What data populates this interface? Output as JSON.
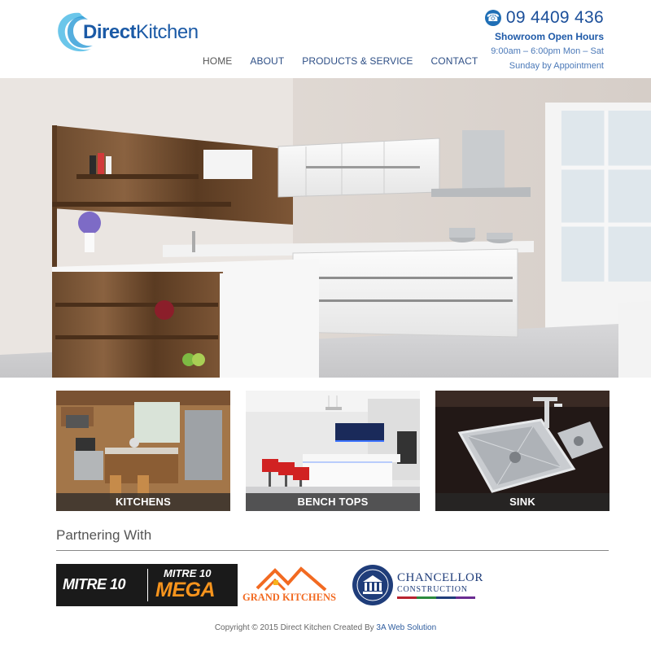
{
  "brand": {
    "name_bold": "Direct",
    "name_light": "Kitchen"
  },
  "nav": {
    "items": [
      {
        "label": "HOME"
      },
      {
        "label": "ABOUT"
      },
      {
        "label": "PRODUCTS & SERVICE"
      },
      {
        "label": "CONTACT"
      }
    ]
  },
  "contact": {
    "phone": "09 4409 436",
    "hours_title": "Showroom Open Hours",
    "hours_line1": "9:00am – 6:00pm Mon – Sat",
    "hours_line2": "Sunday by Appointment"
  },
  "thumbnails": [
    {
      "caption": "KITCHENS"
    },
    {
      "caption": "BENCH TOPS"
    },
    {
      "caption": "SINK"
    }
  ],
  "partners": {
    "title": "Partnering With",
    "mitre10": "MITRE 10",
    "mitre10_mega_top": "MITRE 10",
    "mitre10_mega_bottom": "MEGA",
    "grand_kitchens": "GRAND KITCHENS",
    "chancellor_top": "CHANCELLOR",
    "chancellor_bottom": "CONSTRUCTION"
  },
  "footer": {
    "text": "Copyright © 2015 Direct Kitchen Created By ",
    "link": "3A Web Solution"
  },
  "colors": {
    "brand_blue": "#1b5aa6",
    "nav_blue": "#2e4f86",
    "mitre_orange": "#f7941d"
  }
}
